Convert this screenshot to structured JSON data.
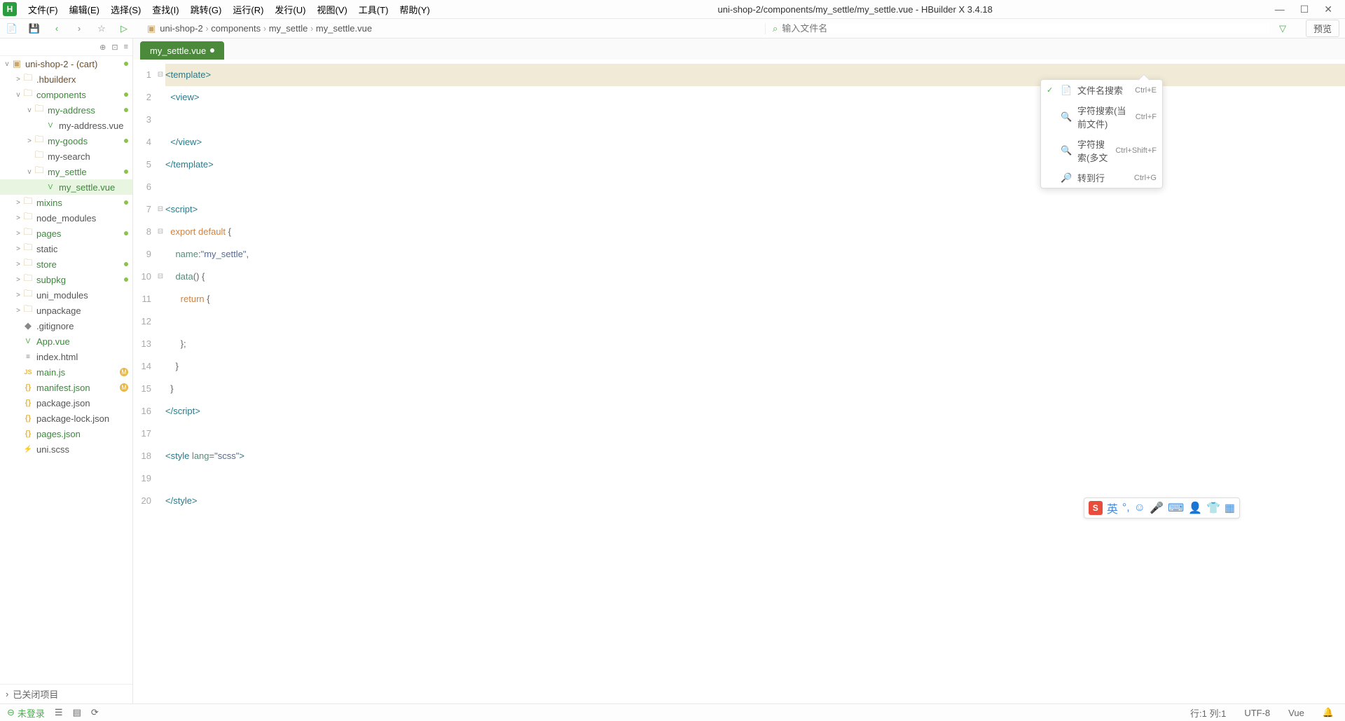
{
  "app": {
    "title": "uni-shop-2/components/my_settle/my_settle.vue - HBuilder X 3.4.18"
  },
  "menubar": {
    "items": [
      "文件(F)",
      "编辑(E)",
      "选择(S)",
      "查找(I)",
      "跳转(G)",
      "运行(R)",
      "发行(U)",
      "视图(V)",
      "工具(T)",
      "帮助(Y)"
    ]
  },
  "toolbar": {
    "breadcrumbs": [
      "uni-shop-2",
      "components",
      "my_settle",
      "my_settle.vue"
    ],
    "search_placeholder": "输入文件名",
    "preview": "预览"
  },
  "sidebar": {
    "project_root": "uni-shop-2 - (cart)",
    "tree": [
      {
        "indent": 1,
        "chev": ">",
        "icon": "folder",
        "label": ".hbuilderx",
        "color": "dim"
      },
      {
        "indent": 1,
        "chev": "v",
        "icon": "folder",
        "label": "components",
        "green": true,
        "dot": true
      },
      {
        "indent": 2,
        "chev": "v",
        "icon": "folder",
        "label": "my-address",
        "green": true,
        "dot": true
      },
      {
        "indent": 3,
        "chev": "",
        "icon": "vue",
        "label": "my-address.vue",
        "dim": true
      },
      {
        "indent": 2,
        "chev": ">",
        "icon": "folder",
        "label": "my-goods",
        "green": true,
        "dot": true
      },
      {
        "indent": 2,
        "chev": "",
        "icon": "folder",
        "label": "my-search",
        "dim": true
      },
      {
        "indent": 2,
        "chev": "v",
        "icon": "folder",
        "label": "my_settle",
        "green": true,
        "dot": true,
        "selected": false
      },
      {
        "indent": 3,
        "chev": "",
        "icon": "vue",
        "label": "my_settle.vue",
        "green": true,
        "selected": true
      },
      {
        "indent": 1,
        "chev": ">",
        "icon": "folder",
        "label": "mixins",
        "green": true,
        "dot": true
      },
      {
        "indent": 1,
        "chev": ">",
        "icon": "folder",
        "label": "node_modules",
        "dim": true
      },
      {
        "indent": 1,
        "chev": ">",
        "icon": "folder",
        "label": "pages",
        "green": true,
        "dot": true
      },
      {
        "indent": 1,
        "chev": ">",
        "icon": "folder",
        "label": "static",
        "dim": true
      },
      {
        "indent": 1,
        "chev": ">",
        "icon": "folder",
        "label": "store",
        "green": true,
        "dot": true
      },
      {
        "indent": 1,
        "chev": ">",
        "icon": "folder",
        "label": "subpkg",
        "green": true,
        "dot": true
      },
      {
        "indent": 1,
        "chev": ">",
        "icon": "folder",
        "label": "uni_modules",
        "dim": true
      },
      {
        "indent": 1,
        "chev": ">",
        "icon": "folder",
        "label": "unpackage",
        "dim": true
      },
      {
        "indent": 1,
        "chev": "",
        "icon": "git",
        "label": ".gitignore",
        "dim": true
      },
      {
        "indent": 1,
        "chev": "",
        "icon": "vue",
        "label": "App.vue",
        "green": true
      },
      {
        "indent": 1,
        "chev": "",
        "icon": "html",
        "label": "index.html",
        "dim": true
      },
      {
        "indent": 1,
        "chev": "",
        "icon": "js",
        "label": "main.js",
        "green": true,
        "m": true
      },
      {
        "indent": 1,
        "chev": "",
        "icon": "json",
        "label": "manifest.json",
        "green": true,
        "m": true
      },
      {
        "indent": 1,
        "chev": "",
        "icon": "json",
        "label": "package.json",
        "dim": true
      },
      {
        "indent": 1,
        "chev": "",
        "icon": "json",
        "label": "package-lock.json",
        "dim": true
      },
      {
        "indent": 1,
        "chev": "",
        "icon": "json",
        "label": "pages.json",
        "green": true
      },
      {
        "indent": 1,
        "chev": "",
        "icon": "scss",
        "label": "uni.scss",
        "dim": true
      }
    ],
    "closed_projects": "已关闭项目"
  },
  "tabs": {
    "active": "my_settle.vue"
  },
  "code_lines": [
    [
      {
        "t": "<template>",
        "c": "tag"
      }
    ],
    [
      {
        "t": "  "
      },
      {
        "t": "<view>",
        "c": "tag"
      }
    ],
    [
      {
        "t": "    "
      }
    ],
    [
      {
        "t": "  "
      },
      {
        "t": "</view>",
        "c": "tag"
      }
    ],
    [
      {
        "t": "</template>",
        "c": "tag"
      }
    ],
    [],
    [
      {
        "t": "<script>",
        "c": "tag"
      }
    ],
    [
      {
        "t": "  "
      },
      {
        "t": "export",
        "c": "kw"
      },
      {
        "t": " "
      },
      {
        "t": "default",
        "c": "kw"
      },
      {
        "t": " {",
        "c": "punct"
      }
    ],
    [
      {
        "t": "    "
      },
      {
        "t": "name",
        "c": "attr"
      },
      {
        "t": ":",
        "c": "punct"
      },
      {
        "t": "\"my_settle\"",
        "c": "str"
      },
      {
        "t": ",",
        "c": "punct"
      }
    ],
    [
      {
        "t": "    "
      },
      {
        "t": "data",
        "c": "fn"
      },
      {
        "t": "() {",
        "c": "punct"
      }
    ],
    [
      {
        "t": "      "
      },
      {
        "t": "return",
        "c": "kw"
      },
      {
        "t": " {",
        "c": "punct"
      }
    ],
    [
      {
        "t": "        "
      }
    ],
    [
      {
        "t": "      "
      },
      {
        "t": "};",
        "c": "punct"
      }
    ],
    [
      {
        "t": "    "
      },
      {
        "t": "}",
        "c": "punct"
      }
    ],
    [
      {
        "t": "  "
      },
      {
        "t": "}",
        "c": "punct"
      }
    ],
    [
      {
        "t": "</script>",
        "c": "tag"
      }
    ],
    [],
    [
      {
        "t": "<style ",
        "c": "tag"
      },
      {
        "t": "lang",
        "c": "attr"
      },
      {
        "t": "=",
        "c": "punct"
      },
      {
        "t": "\"scss\"",
        "c": "str"
      },
      {
        "t": ">",
        "c": "tag"
      }
    ],
    [],
    [
      {
        "t": "</style>",
        "c": "tag"
      }
    ]
  ],
  "fold_markers": {
    "1": "⊟",
    "7": "⊟",
    "8": "⊟",
    "10": "⊟"
  },
  "search_popup": {
    "items": [
      {
        "active": true,
        "icon": "📄",
        "label": "文件名搜索",
        "shortcut": "Ctrl+E"
      },
      {
        "active": false,
        "icon": "🔍",
        "label": "字符搜索(当前文件)",
        "shortcut": "Ctrl+F"
      },
      {
        "active": false,
        "icon": "🔍",
        "label": "字符搜索(多文",
        "shortcut": "Ctrl+Shift+F"
      },
      {
        "active": false,
        "icon": "🔎",
        "label": "转到行",
        "shortcut": "Ctrl+G"
      }
    ]
  },
  "ime": {
    "lang": "英"
  },
  "statusbar": {
    "login": "未登录",
    "cursor": "行:1  列:1",
    "encoding": "UTF-8",
    "lang": "Vue"
  }
}
